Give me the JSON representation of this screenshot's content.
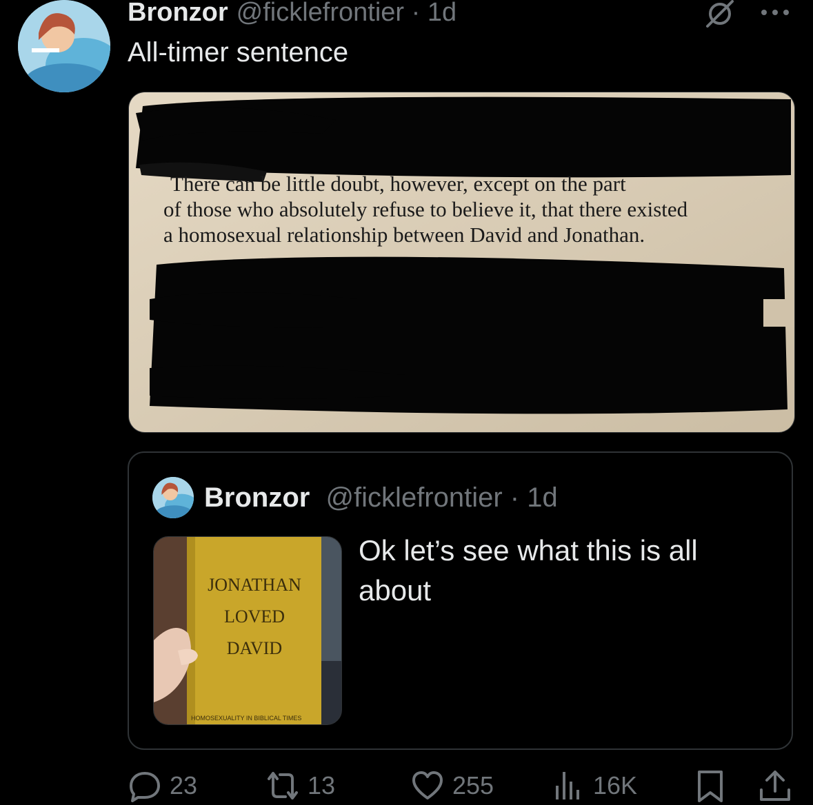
{
  "tweet": {
    "author_name": "Bronzor",
    "author_handle": "@ficklefrontier · 1d",
    "text": "All-timer sentence",
    "icons": [
      "grok-icon",
      "more-icon"
    ],
    "image_text": {
      "line1": "There can be little doubt, however, except on the part",
      "line2": "of those who absolutely refuse to believe it, that there existed",
      "line3": "a homosexual relationship between David and Jonathan."
    }
  },
  "quoted_tweet": {
    "author_name": "Bronzor",
    "author_handle": "@ficklefrontier · 1d",
    "text": "Ok let’s see what this is all about",
    "book_cover": {
      "title_line1": "JONATHAN",
      "title_line2": "LOVED",
      "title_line3": "DAVID",
      "subtitle": "HOMOSEXUALITY IN BIBLICAL TIMES"
    }
  },
  "actions": {
    "replies": "23",
    "retweets": "13",
    "likes": "255",
    "views": "16K"
  },
  "colors": {
    "background": "#000000",
    "primary_text": "#e7e9ea",
    "secondary_text": "#71767b",
    "border": "#2f3336",
    "book_yellow": "#c9a62a",
    "paper": "#d8cbb6"
  }
}
